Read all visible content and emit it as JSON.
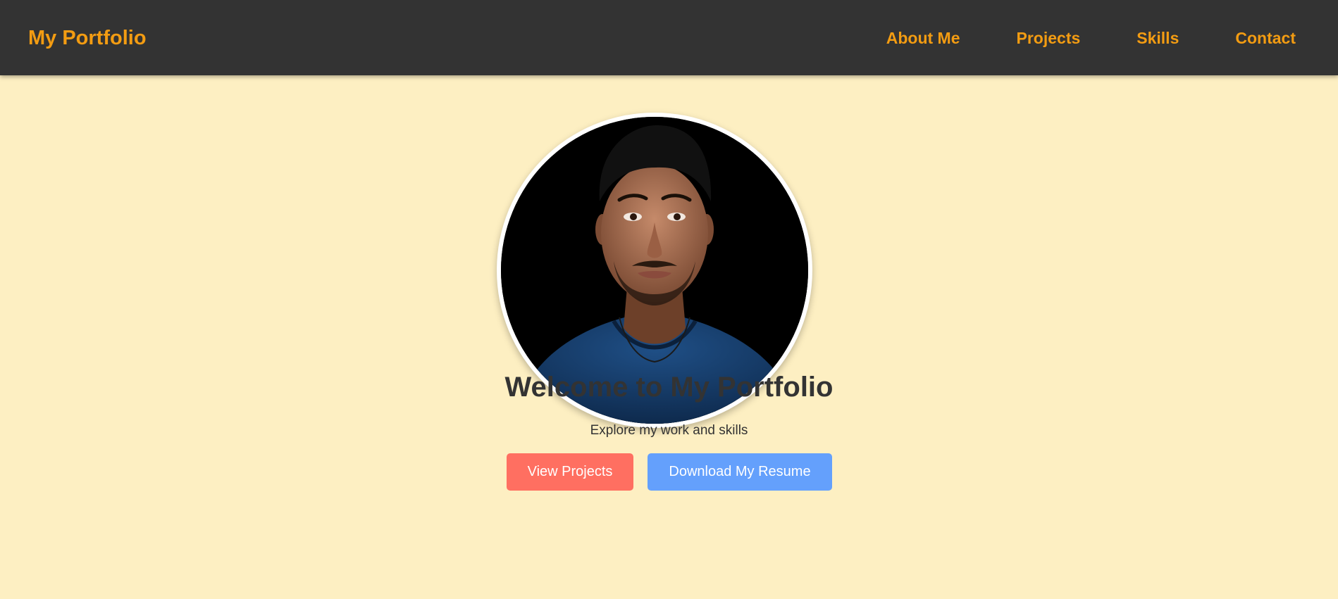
{
  "header": {
    "brand": "My Portfolio",
    "nav": [
      {
        "label": "About Me"
      },
      {
        "label": "Projects"
      },
      {
        "label": "Skills"
      },
      {
        "label": "Contact"
      }
    ]
  },
  "hero": {
    "title": "Welcome to My Portfolio",
    "subtitle": "Explore my work and skills",
    "buttons": {
      "projects": "View Projects",
      "resume": "Download My Resume"
    }
  },
  "colors": {
    "background": "#fdefc2",
    "topbar": "#333333",
    "accent": "#f39c12",
    "button_projects": "#ff6f61",
    "button_resume": "#64a0fc"
  }
}
